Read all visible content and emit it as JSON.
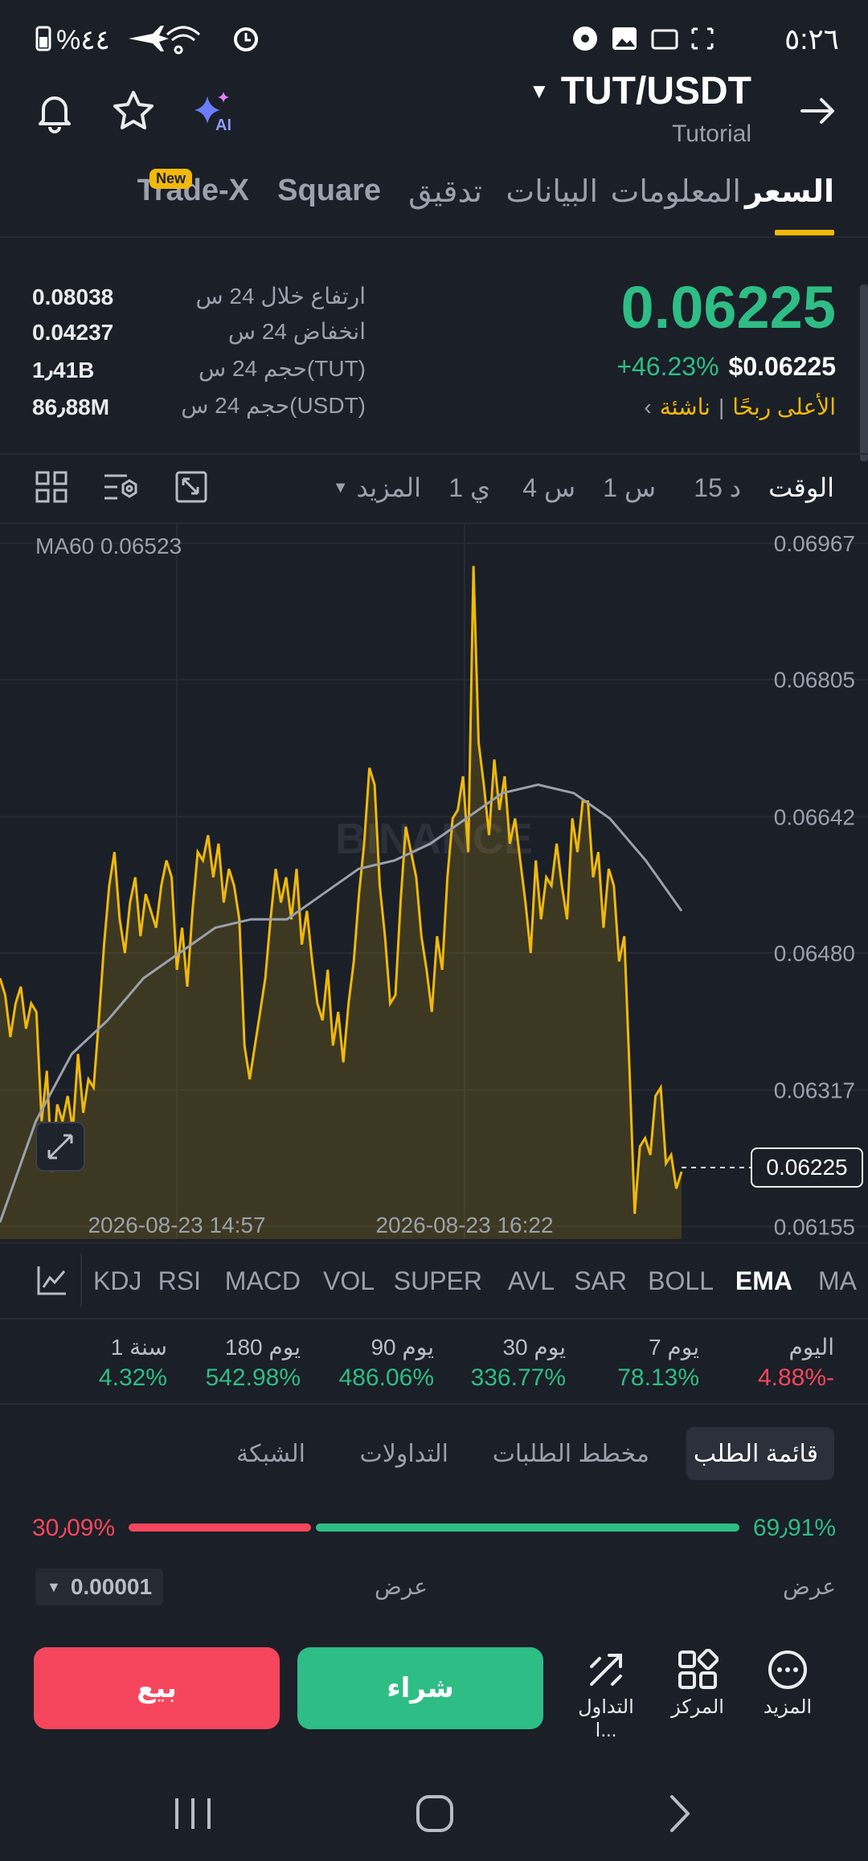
{
  "status_bar": {
    "time": "٥:٢٦",
    "battery": "%٤٤"
  },
  "header": {
    "pair": "TUT/USDT",
    "subtitle": "Tutorial"
  },
  "tabs": [
    "السعر",
    "المعلومات",
    "البيانات",
    "تدقيق",
    "Square",
    "Trade-X"
  ],
  "new_badge": "New",
  "price": {
    "last": "0.06225",
    "change": "+46.23%",
    "usd": "$0.06225",
    "tag1": "الأعلى ربحًا",
    "tag2": "ناشئة"
  },
  "stats": [
    {
      "label": "ارتفاع خلال 24 س",
      "value": "0.08038"
    },
    {
      "label": "انخفاض 24 س",
      "value": "0.04237"
    },
    {
      "label": "حجم 24 س(TUT)",
      "value": "1٫41B"
    },
    {
      "label": "حجم 24 س(USDT)",
      "value": "86٫88M"
    }
  ],
  "timeframes": [
    "الوقت",
    "15 د",
    "1 س",
    "4 س",
    "1 ي",
    "المزيد"
  ],
  "ma_label": "MA60 0.06523",
  "watermark": "BINANCE",
  "chart_data": {
    "type": "line",
    "x": [
      "2026-08-23 14:57",
      "2026-08-23 16:22"
    ],
    "y_ticks": [
      0.06967,
      0.06805,
      0.06642,
      0.0648,
      0.06317,
      0.06155
    ],
    "ylim": [
      0.0614,
      0.0699
    ],
    "current": 0.06225,
    "series": [
      {
        "name": "",
        "values": [
          0.0645,
          0.0643,
          0.0638,
          0.0642,
          0.0644,
          0.0639,
          0.0642,
          0.0641,
          0.0628,
          0.0634,
          0.0622,
          0.063,
          0.0628,
          0.0631,
          0.0627,
          0.0636,
          0.0629,
          0.0633,
          0.0632,
          0.064,
          0.0649,
          0.0656,
          0.066,
          0.0652,
          0.0648,
          0.0654,
          0.0657,
          0.065,
          0.0655,
          0.0653,
          0.0651,
          0.0656,
          0.0659,
          0.0657,
          0.0646,
          0.0651,
          0.0644,
          0.0653,
          0.066,
          0.0659,
          0.0662,
          0.0657,
          0.0661,
          0.0654,
          0.0658,
          0.0656,
          0.0652,
          0.0637,
          0.0633,
          0.0637,
          0.0641,
          0.0645,
          0.0652,
          0.0658,
          0.0654,
          0.0657,
          0.0652,
          0.0658,
          0.0649,
          0.0653,
          0.0647,
          0.0642,
          0.064,
          0.0646,
          0.0637,
          0.0641,
          0.0635,
          0.0642,
          0.0647,
          0.0655,
          0.0661,
          0.067,
          0.0668,
          0.0656,
          0.065,
          0.0642,
          0.0643,
          0.0654,
          0.0663,
          0.066,
          0.0657,
          0.065,
          0.0646,
          0.0641,
          0.065,
          0.0646,
          0.0657,
          0.0664,
          0.0665,
          0.0669,
          0.066,
          0.0694,
          0.0673,
          0.0668,
          0.0662,
          0.0671,
          0.0665,
          0.0669,
          0.0661,
          0.0664,
          0.0659,
          0.0654,
          0.0648,
          0.0659,
          0.0652,
          0.0657,
          0.0656,
          0.0661,
          0.0656,
          0.0652,
          0.0664,
          0.066,
          0.0666,
          0.0666,
          0.0657,
          0.066,
          0.0651,
          0.0658,
          0.0656,
          0.0647,
          0.065,
          0.0634,
          0.0617,
          0.0625,
          0.0626,
          0.0624,
          0.0631,
          0.0632,
          0.0623,
          0.0624,
          0.062,
          0.0622
        ]
      },
      {
        "name": "",
        "values": [
          0.0616,
          0.0628,
          0.0636,
          0.064,
          0.0645,
          0.0648,
          0.0651,
          0.0652,
          0.0652,
          0.0655,
          0.0658,
          0.0659,
          0.0661,
          0.0664,
          0.0667,
          0.0668,
          0.0667,
          0.0664,
          0.0659,
          0.0653
        ]
      }
    ]
  },
  "indicators": [
    "MA",
    "EMA",
    "BOLL",
    "SAR",
    "AVL",
    "SUPER",
    "VOL",
    "MACD",
    "RSI",
    "KDJ"
  ],
  "performance": [
    {
      "label": "اليوم",
      "value": "4.88%-",
      "color": "#f6465d"
    },
    {
      "label": "7 يوم",
      "value": "78.13%",
      "color": "#2ebd85"
    },
    {
      "label": "30 يوم",
      "value": "336.77%",
      "color": "#2ebd85"
    },
    {
      "label": "90 يوم",
      "value": "486.06%",
      "color": "#2ebd85"
    },
    {
      "label": "180 يوم",
      "value": "542.98%",
      "color": "#2ebd85"
    },
    {
      "label": "1 سنة",
      "value": "4.32%",
      "color": "#2ebd85"
    }
  ],
  "orderbook": {
    "tabs": [
      "قائمة الطلب",
      "مخطط الطلبات",
      "التداولات",
      "الشبكة"
    ],
    "buy_ratio": "69٫91%",
    "sell_ratio": "30٫09%",
    "buy_pct": 0.6991,
    "col1": "عرض",
    "col2": "عرض",
    "precision": "0.00001"
  },
  "actions": {
    "buy": "شراء",
    "sell": "بيع",
    "more": "المزيد",
    "center": "المركز",
    "trade": "التداول ا..."
  },
  "colors": {
    "up": "#2ebd85",
    "down": "#f6465d",
    "accent": "#f0b90b",
    "bg": "#1b1f27"
  }
}
